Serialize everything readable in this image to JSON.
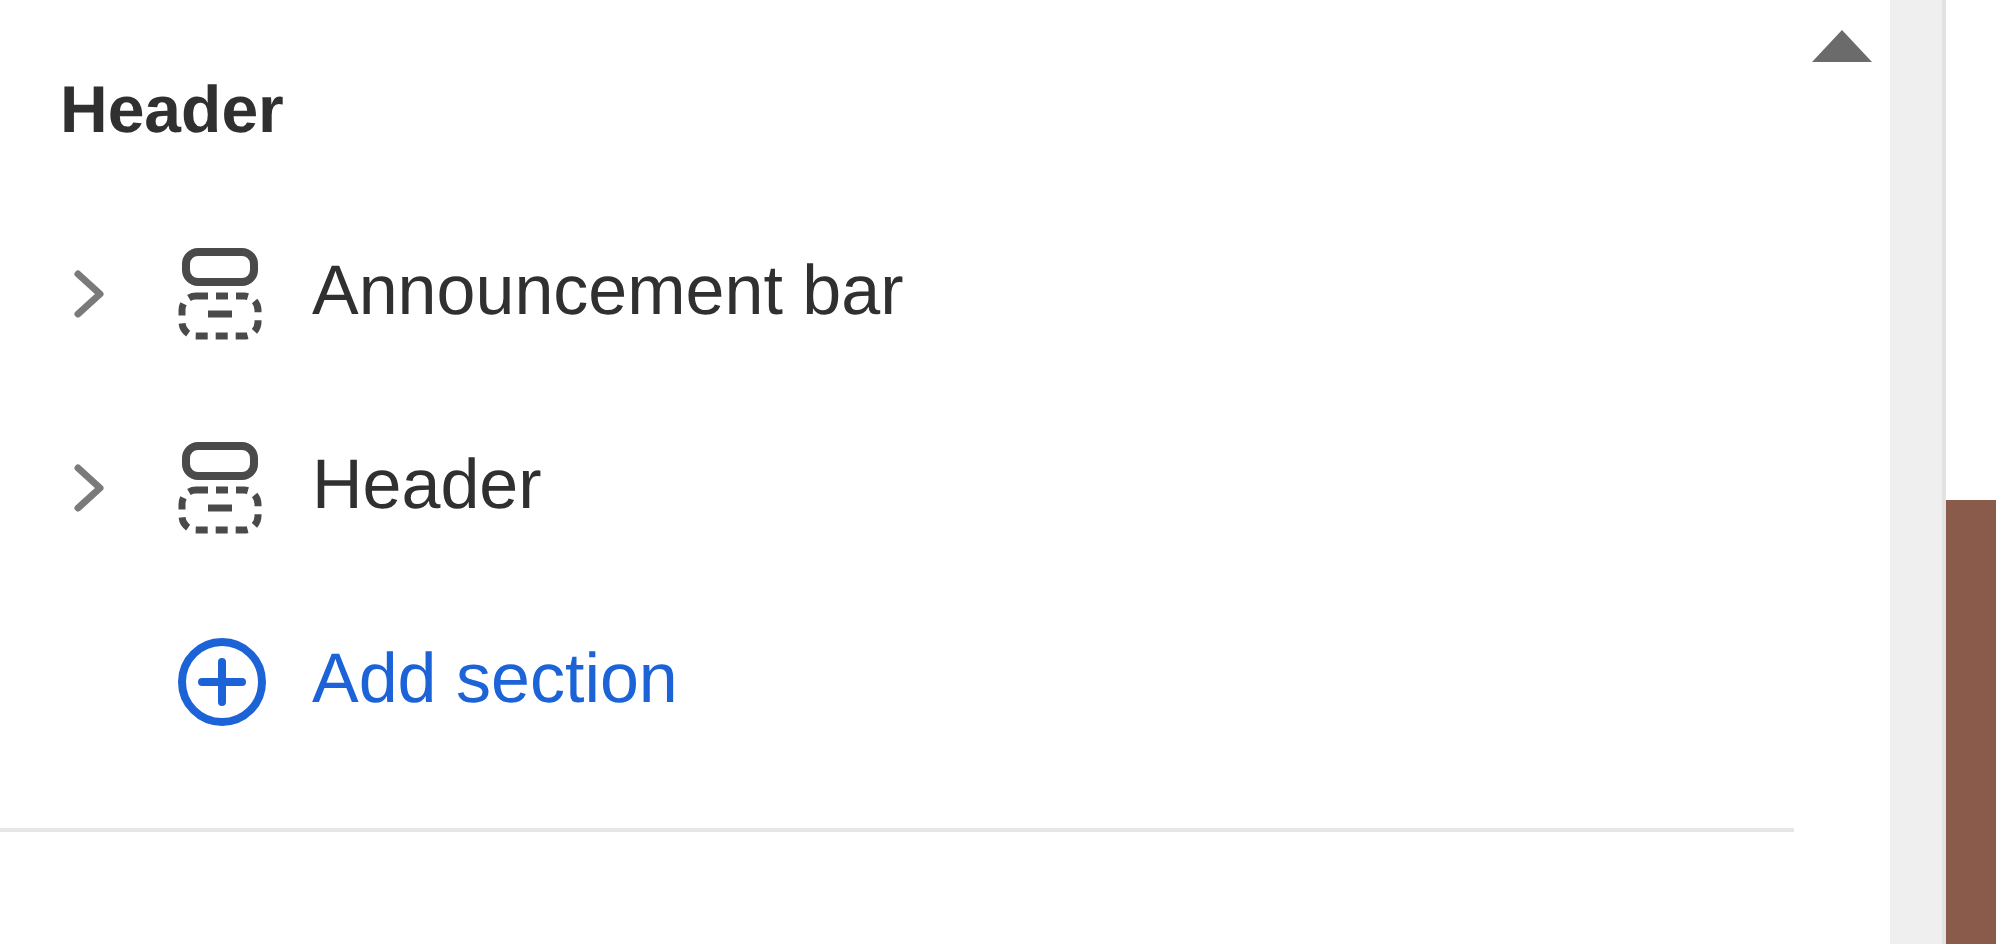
{
  "group_title": "Header",
  "sections": [
    {
      "label": "Announcement bar",
      "expanded": false
    },
    {
      "label": "Header",
      "expanded": false
    }
  ],
  "add_section": {
    "label": "Add section"
  }
}
